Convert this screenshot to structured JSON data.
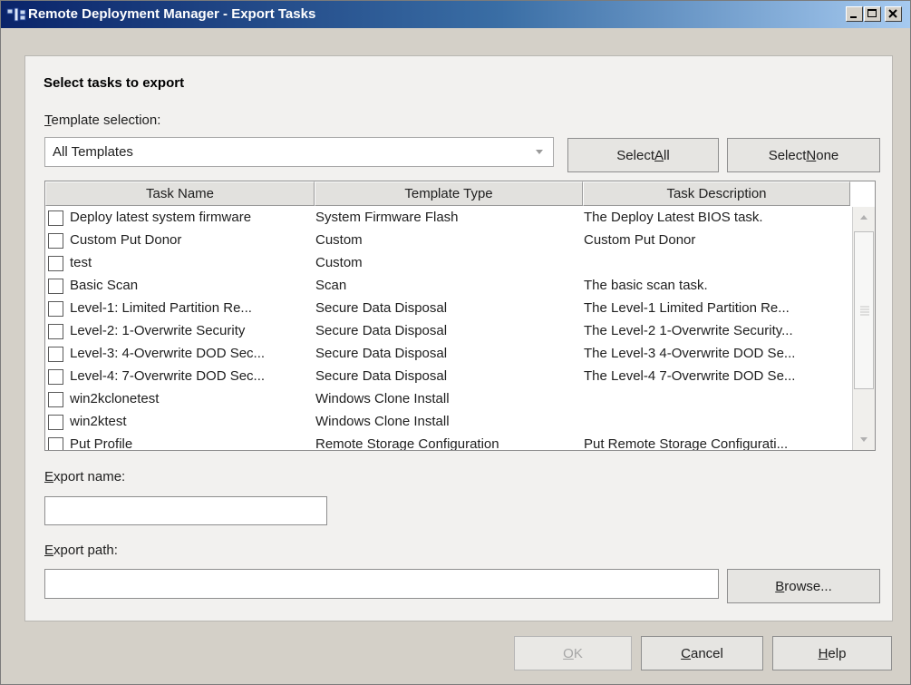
{
  "window": {
    "title": "Remote Deployment Manager - Export Tasks",
    "controls": {
      "minimize": "minimize",
      "maximize": "maximize",
      "close": "close"
    }
  },
  "section": {
    "heading": "Select tasks to export"
  },
  "template_selection": {
    "label": "Template selection:",
    "value": "All Templates"
  },
  "buttons": {
    "select_all": {
      "pre": "Select ",
      "accel": "A",
      "post": "ll"
    },
    "select_none": {
      "pre": "Select ",
      "accel": "N",
      "post": "one"
    },
    "browse": {
      "pre": "",
      "accel": "B",
      "post": "rowse..."
    },
    "ok": {
      "pre": "",
      "accel": "O",
      "post": "K"
    },
    "cancel": {
      "pre": "",
      "accel": "C",
      "post": "ancel"
    },
    "help": {
      "pre": "",
      "accel": "H",
      "post": "elp"
    }
  },
  "table": {
    "headers": [
      "Task Name",
      "Template Type",
      "Task Description"
    ],
    "rows": [
      {
        "name": "Deploy latest system firmware",
        "type": "System Firmware Flash",
        "description": "The Deploy Latest BIOS task."
      },
      {
        "name": "Custom Put Donor",
        "type": "Custom",
        "description": "Custom Put Donor"
      },
      {
        "name": "test",
        "type": "Custom",
        "description": ""
      },
      {
        "name": "Basic Scan",
        "type": "Scan",
        "description": "The basic scan task."
      },
      {
        "name": "Level-1: Limited Partition Re...",
        "type": "Secure Data Disposal",
        "description": "The Level-1 Limited Partition Re..."
      },
      {
        "name": "Level-2: 1-Overwrite Security",
        "type": "Secure Data Disposal",
        "description": "The Level-2 1-Overwrite Security..."
      },
      {
        "name": "Level-3: 4-Overwrite DOD Sec...",
        "type": "Secure Data Disposal",
        "description": "The Level-3 4-Overwrite DOD Se..."
      },
      {
        "name": "Level-4: 7-Overwrite DOD Sec...",
        "type": "Secure Data Disposal",
        "description": "The Level-4 7-Overwrite DOD Se..."
      },
      {
        "name": "win2kclonetest",
        "type": "Windows Clone Install",
        "description": ""
      },
      {
        "name": "win2ktest",
        "type": "Windows Clone Install",
        "description": ""
      },
      {
        "name": "Put Profile",
        "type": "Remote Storage Configuration",
        "description": "Put Remote Storage Configurati..."
      }
    ]
  },
  "export_name": {
    "label": "Export name:",
    "value": ""
  },
  "export_path": {
    "label": "Export path:",
    "value": ""
  },
  "colors": {
    "title_start": "#0a246a",
    "title_end": "#a6caf0",
    "dialog_bg": "#d4d0c8",
    "panel_bg": "#f2f1ef"
  }
}
